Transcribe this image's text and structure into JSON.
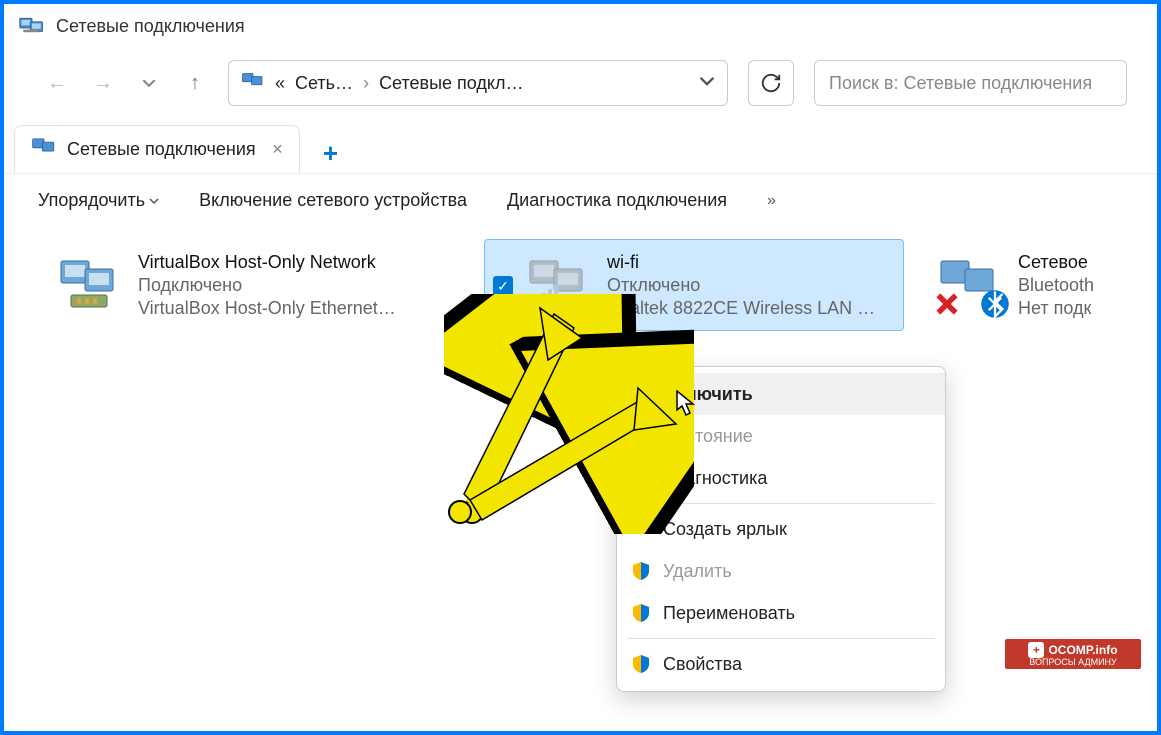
{
  "title": "Сетевые подключения",
  "breadcrumb": {
    "prefix": "«",
    "part1": "Сеть…",
    "part2": "Сетевые подкл…"
  },
  "search": {
    "placeholder": "Поиск в: Сетевые подключения"
  },
  "tab": {
    "label": "Сетевые подключения"
  },
  "toolbar": {
    "organize": "Упорядочить",
    "enable_device": "Включение сетевого устройства",
    "diagnose": "Диагностика подключения",
    "more": "»"
  },
  "connections": [
    {
      "id": "vbox",
      "name": "VirtualBox Host-Only Network",
      "status": "Подключено",
      "device": "VirtualBox Host-Only Ethernet…"
    },
    {
      "id": "wifi",
      "name": "wi-fi",
      "status": "Отключено",
      "device": "Realtek 8822CE Wireless LAN …",
      "selected": true
    },
    {
      "id": "bt",
      "name": "Сетевое",
      "status": "Bluetooth",
      "device": "Нет подк"
    }
  ],
  "context_menu": {
    "enable": "Включить",
    "state": "Состояние",
    "diag": "Диагностика",
    "shortcut": "Создать ярлык",
    "delete": "Удалить",
    "rename": "Переименовать",
    "props": "Свойства"
  },
  "watermark": {
    "line1": "OCOMP.info",
    "line2": "ВОПРОСЫ АДМИНУ"
  }
}
